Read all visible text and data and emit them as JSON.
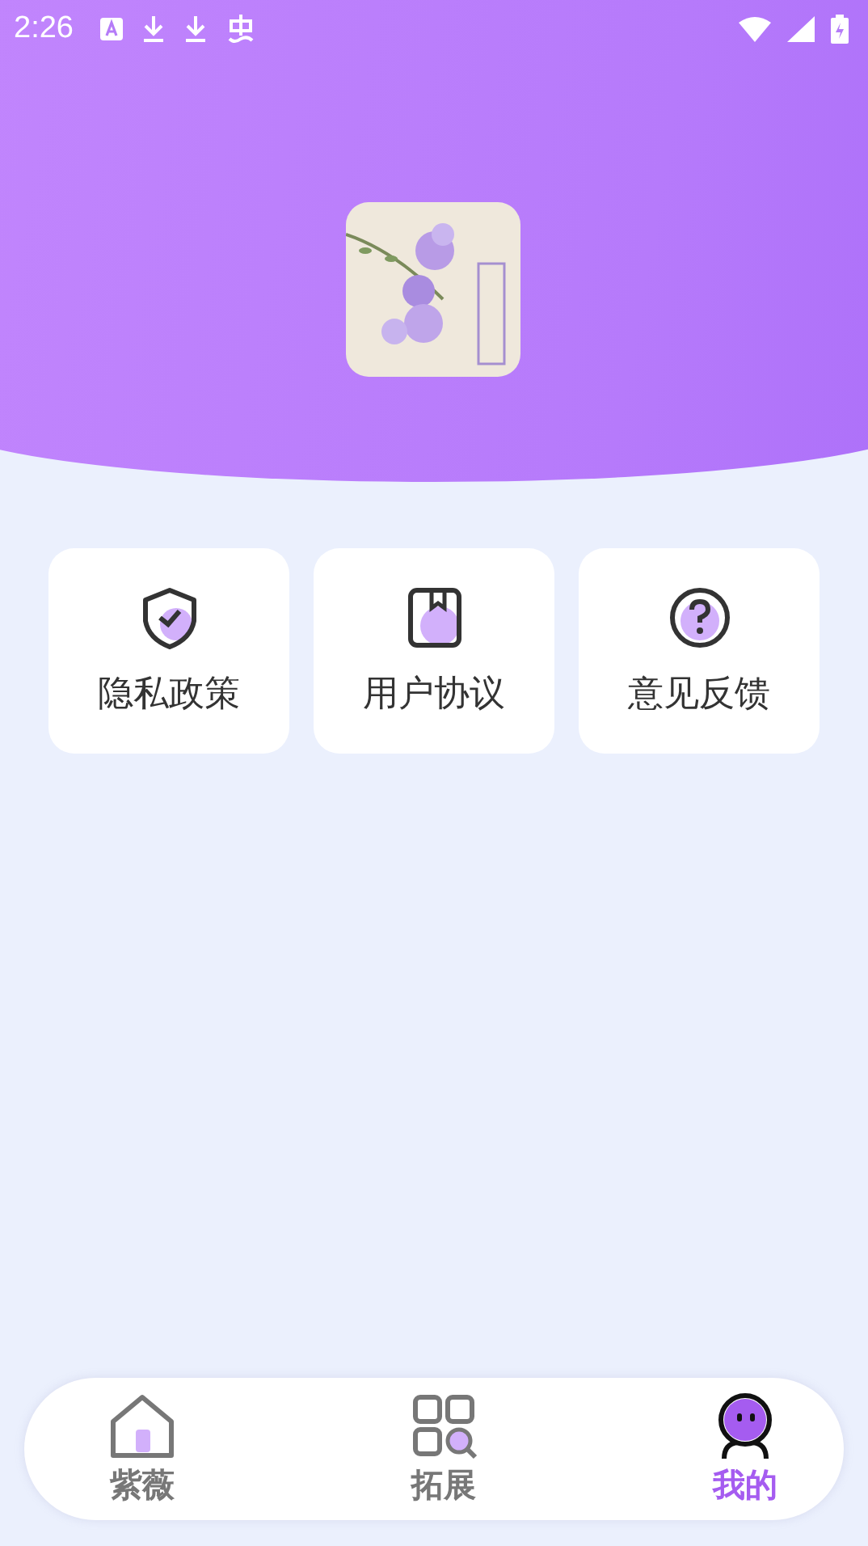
{
  "status_bar": {
    "time": "2:26"
  },
  "menu_cards": [
    {
      "kind": "shield",
      "label": "隐私政策"
    },
    {
      "kind": "book",
      "label": "用户协议"
    },
    {
      "kind": "question",
      "label": "意见反馈"
    }
  ],
  "bottom_nav": [
    {
      "kind": "home",
      "label": "紫薇",
      "selected": false
    },
    {
      "kind": "apps",
      "label": "拓展",
      "selected": false
    },
    {
      "kind": "profile",
      "label": "我的",
      "selected": true
    }
  ]
}
